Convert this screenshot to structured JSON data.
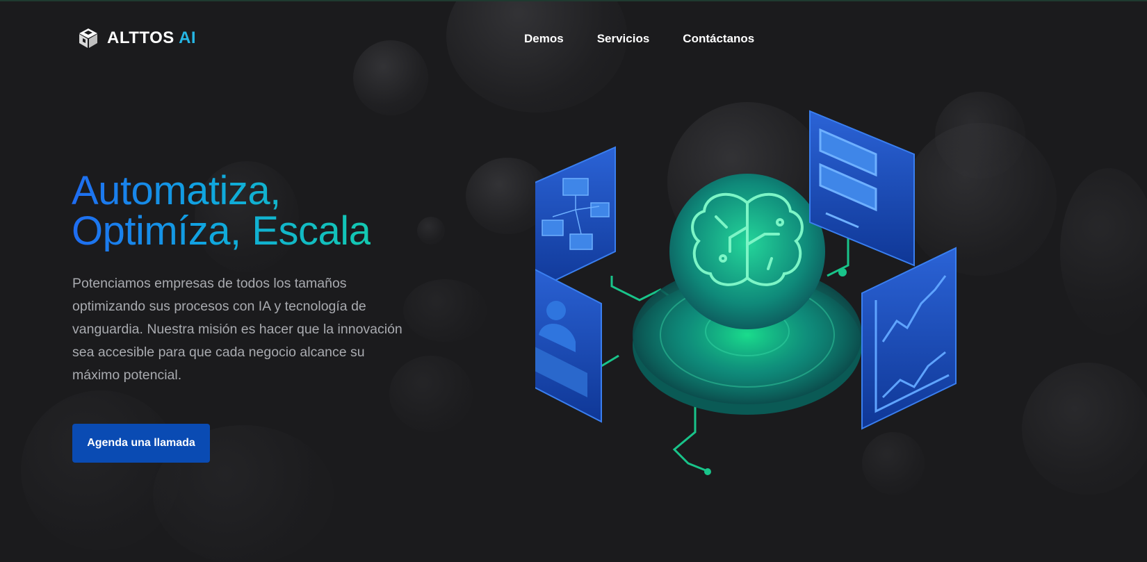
{
  "brand": {
    "name_main": "ALTTOS ",
    "name_accent": "AI",
    "logo_icon": "cube-logo-icon"
  },
  "nav": {
    "items": [
      {
        "label": "Demos"
      },
      {
        "label": "Servicios"
      },
      {
        "label": "Contáctanos"
      }
    ]
  },
  "hero": {
    "title_line1": "Automatiza,",
    "title_line2": "Optimíza, Escala",
    "description": "Potenciamos empresas de todos los tamaños optimizando sus procesos con IA y tecnología de vanguardia. Nuestra misión es hacer que la innovación sea accesible para que cada negocio alcance su máximo potencial.",
    "cta_label": "Agenda una llamada"
  },
  "illustration": {
    "icons": [
      "brain-icon",
      "flowchart-icon",
      "user-profile-icon",
      "document-icon",
      "growth-chart-icon"
    ]
  },
  "colors": {
    "background": "#1b1b1d",
    "accent_blue": "#1f6cf2",
    "accent_teal": "#13c9b0",
    "cta": "#0a4bb3",
    "glow_green": "#1be38f"
  }
}
